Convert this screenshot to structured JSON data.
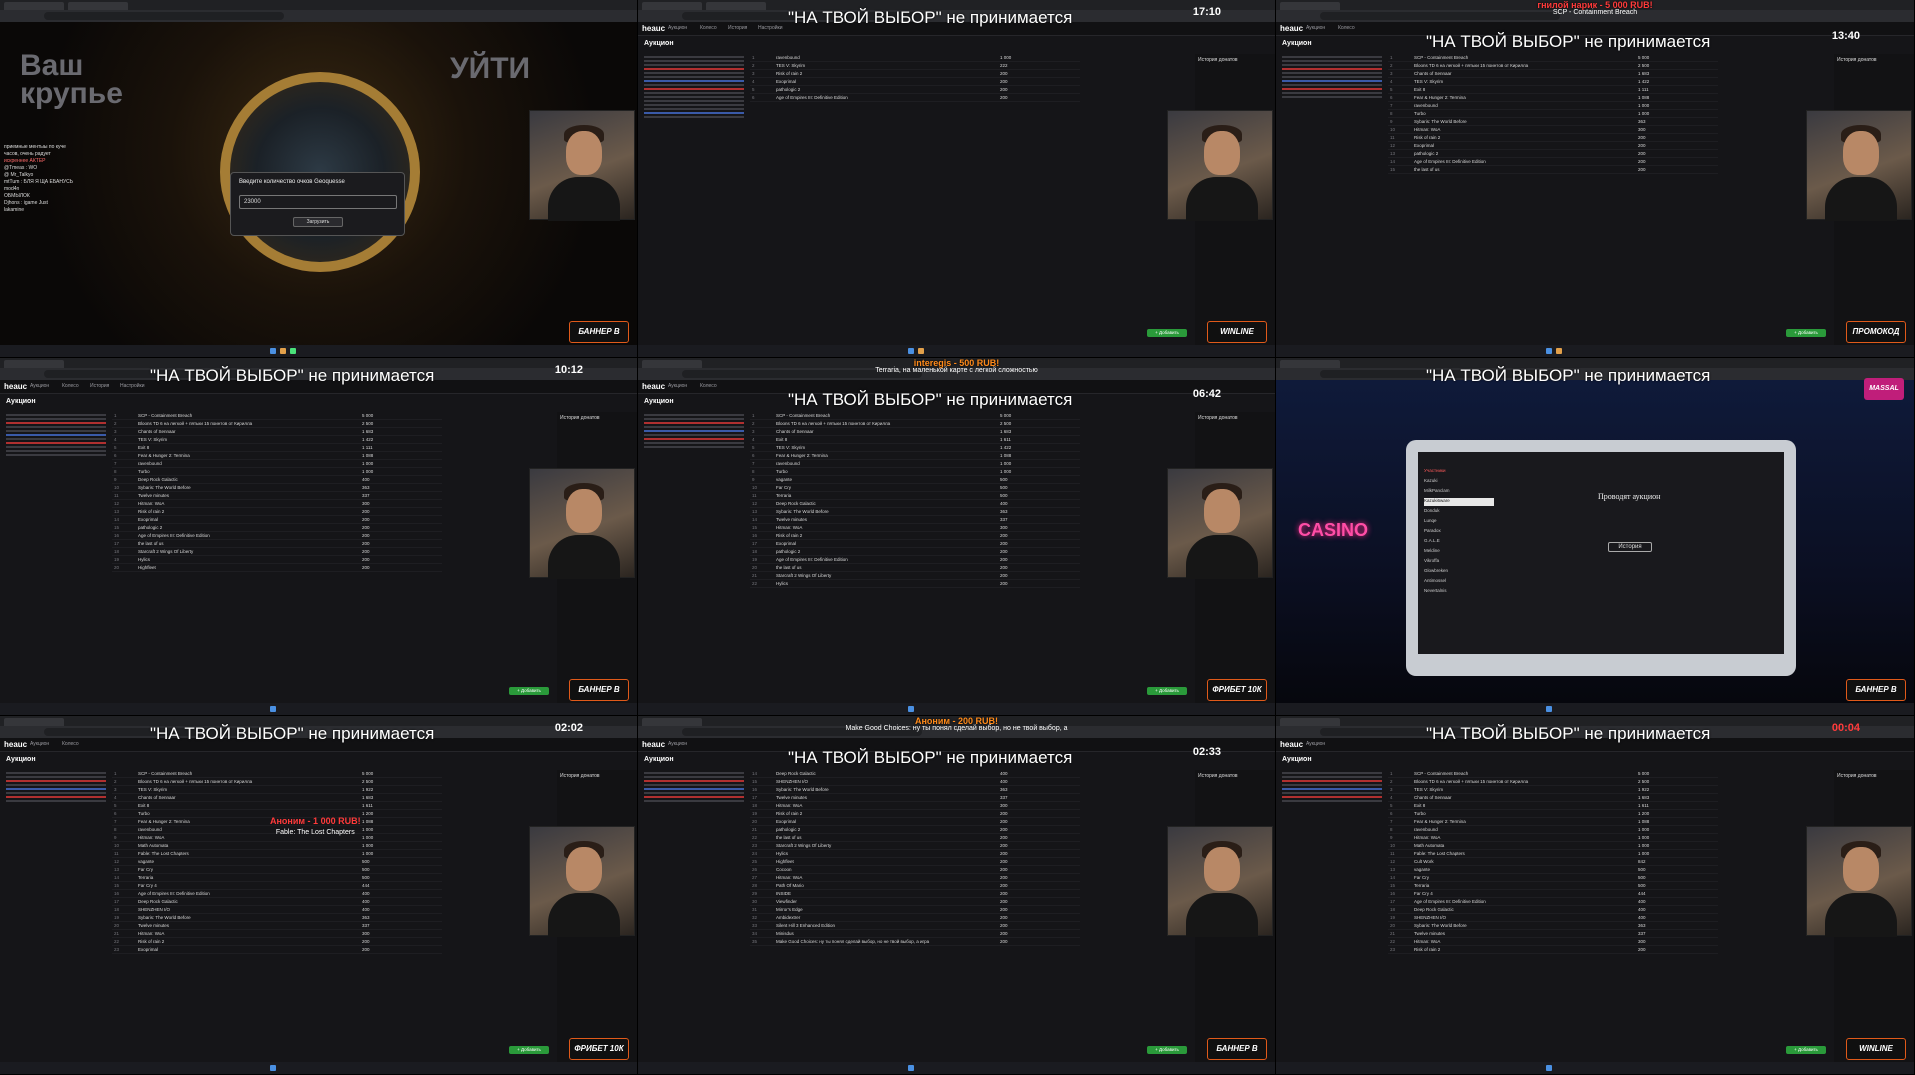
{
  "overlay_banner": "\"НА ТВОЙ ВЫБОР\" не принимается",
  "site": {
    "logo": "heauc",
    "nav": [
      "Аукцион",
      "Колесо",
      "История",
      "Настройки"
    ],
    "auction_label": "Аукцион",
    "add_button": "+ Добавить",
    "history_label": "История донатов"
  },
  "panel1": {
    "left_title": "Ваш крупье",
    "right_title": "УЙТИ",
    "modal_title": "Введите количество очков Geoquesse",
    "modal_value": "23000",
    "modal_button": "Загрузить",
    "chat": [
      "приемные ментыы по куче",
      "часов, очень радует",
      "искреннее АКТЁР",
      "@Tmeas : WO",
      "@ Mr_Talkyo",
      "mtTum : БЛЯ Я ЩА ЕБАНУСЬ",
      "mod4n",
      "ОБМЫЛОК",
      "Djhons : igame Just",
      "lakamine"
    ]
  },
  "panel2": {
    "timer": "17:10",
    "rows": [
      {
        "i": "1",
        "n": "ravenbound",
        "a": "1 000"
      },
      {
        "i": "2",
        "n": "TES V: Skyrim",
        "a": "222"
      },
      {
        "i": "3",
        "n": "Risk of rain 2",
        "a": "200"
      },
      {
        "i": "4",
        "n": "Exoprimal",
        "a": "200"
      },
      {
        "i": "5",
        "n": "pathologic 2",
        "a": "200"
      },
      {
        "i": "6",
        "n": "Age of Empires III: Definitive Edition",
        "a": "200"
      }
    ]
  },
  "panel3": {
    "timer": "13:40",
    "donation": "гнилой нарик - 5 000 RUB!",
    "caption": "SCP - Containment Breach",
    "rows": [
      {
        "i": "1",
        "n": "SCP - Containment Breach",
        "a": "5 000"
      },
      {
        "i": "2",
        "n": "Bloons TD 6 на легкой + пятьки 15 поинтов от Кирилла",
        "a": "2 500"
      },
      {
        "i": "3",
        "n": "Chants of Sennaar",
        "a": "1 683"
      },
      {
        "i": "4",
        "n": "TES V: Skyrim",
        "a": "1 422"
      },
      {
        "i": "5",
        "n": "Exit 8",
        "a": "1 111"
      },
      {
        "i": "6",
        "n": "Fear & Hunger 2: Termina",
        "a": "1 088"
      },
      {
        "i": "7",
        "n": "ravenbound",
        "a": "1 000"
      },
      {
        "i": "8",
        "n": "Turbo",
        "a": "1 000"
      },
      {
        "i": "9",
        "n": "Sybaris: The World Before",
        "a": "363"
      },
      {
        "i": "10",
        "n": "Hitman: WoA",
        "a": "300"
      },
      {
        "i": "11",
        "n": "Risk of rain 2",
        "a": "200"
      },
      {
        "i": "12",
        "n": "Exoprimal",
        "a": "200"
      },
      {
        "i": "13",
        "n": "pathologic 2",
        "a": "200"
      },
      {
        "i": "14",
        "n": "Age of Empires III: Definitive Edition",
        "a": "200"
      },
      {
        "i": "15",
        "n": "the last of us",
        "a": "200"
      }
    ],
    "badge": "ПРОМОКОД MEL"
  },
  "panel4": {
    "timer": "10:12",
    "badge": "БАННЕР В ОПИСАНИИ",
    "rows": [
      {
        "i": "1",
        "n": "SCP - Containment Breach",
        "a": "5 000"
      },
      {
        "i": "2",
        "n": "Bloons TD 6 на легкой + пятьки 15 поинтов от Кирилла",
        "a": "2 500"
      },
      {
        "i": "3",
        "n": "Chants of Sennaar",
        "a": "1 683"
      },
      {
        "i": "4",
        "n": "TES V: Skyrim",
        "a": "1 422"
      },
      {
        "i": "5",
        "n": "Exit 8",
        "a": "1 111"
      },
      {
        "i": "6",
        "n": "Fear & Hunger 2: Termina",
        "a": "1 088"
      },
      {
        "i": "7",
        "n": "ravenbound",
        "a": "1 000"
      },
      {
        "i": "8",
        "n": "Turbo",
        "a": "1 000"
      },
      {
        "i": "9",
        "n": "Deep Rock Galactic",
        "a": "400"
      },
      {
        "i": "10",
        "n": "Sybaris: The World Before",
        "a": "363"
      },
      {
        "i": "11",
        "n": "Twelve minutes",
        "a": "337"
      },
      {
        "i": "12",
        "n": "Hitman: WoA",
        "a": "300"
      },
      {
        "i": "13",
        "n": "Risk of rain 2",
        "a": "200"
      },
      {
        "i": "14",
        "n": "Exoprimal",
        "a": "200"
      },
      {
        "i": "15",
        "n": "pathologic 2",
        "a": "200"
      },
      {
        "i": "16",
        "n": "Age of Empires III: Definitive Edition",
        "a": "200"
      },
      {
        "i": "17",
        "n": "the last of us",
        "a": "200"
      },
      {
        "i": "18",
        "n": "Starcraft 2 Wings Of Liberty",
        "a": "200"
      },
      {
        "i": "19",
        "n": "Hylics",
        "a": "200"
      },
      {
        "i": "20",
        "n": "Highfleet",
        "a": "200"
      }
    ]
  },
  "panel5": {
    "timer": "06:42",
    "donation": "interegis - 500 RUB!",
    "caption": "Terraria, на маленькой карте с легкой сложностью",
    "badge": "ФРИБЕТ 10К",
    "rows": [
      {
        "i": "1",
        "n": "SCP - Containment Breach",
        "a": "5 000"
      },
      {
        "i": "2",
        "n": "Bloons TD 6 на легкой + пятьки 15 поинтов от Кирилла",
        "a": "2 500"
      },
      {
        "i": "3",
        "n": "Chants of Sennaar",
        "a": "1 683"
      },
      {
        "i": "4",
        "n": "Exit 8",
        "a": "1 611"
      },
      {
        "i": "5",
        "n": "TES V: Skyrim",
        "a": "1 422"
      },
      {
        "i": "6",
        "n": "Fear & Hunger 2: Termina",
        "a": "1 088"
      },
      {
        "i": "7",
        "n": "ravenbound",
        "a": "1 000"
      },
      {
        "i": "8",
        "n": "Turbo",
        "a": "1 000"
      },
      {
        "i": "9",
        "n": "vagante",
        "a": "500"
      },
      {
        "i": "10",
        "n": "Far Cry",
        "a": "500"
      },
      {
        "i": "11",
        "n": "Terraria",
        "a": "500"
      },
      {
        "i": "12",
        "n": "Deep Rock Galactic",
        "a": "400"
      },
      {
        "i": "13",
        "n": "Sybaris: The World Before",
        "a": "363"
      },
      {
        "i": "14",
        "n": "Twelve minutes",
        "a": "337"
      },
      {
        "i": "15",
        "n": "Hitman: WoA",
        "a": "300"
      },
      {
        "i": "16",
        "n": "Risk of rain 2",
        "a": "200"
      },
      {
        "i": "17",
        "n": "Exoprimal",
        "a": "200"
      },
      {
        "i": "18",
        "n": "pathologic 2",
        "a": "200"
      },
      {
        "i": "19",
        "n": "Age of Empires III: Definitive Edition",
        "a": "200"
      },
      {
        "i": "20",
        "n": "the last of us",
        "a": "200"
      },
      {
        "i": "21",
        "n": "Starcraft 2 Wings Of Liberty",
        "a": "200"
      },
      {
        "i": "22",
        "n": "Hylics",
        "a": "200"
      }
    ]
  },
  "panel6": {
    "casino_sign": "CASINO",
    "process_text": "Проводят аукцион",
    "history_button": "История",
    "brand_badge": "MASSAL",
    "badge": "БАННЕР В ОПИСАНИИ",
    "participants": [
      "Участники",
      "Kazuki",
      "MilkPanclam",
      "Kazuki6ware",
      "Donduk",
      "Lunqe",
      "Paradox",
      "G.A.L.E",
      "Meldine",
      "Vikroffa",
      "Glowbreken",
      "Antimossel",
      "Nevertalnis"
    ]
  },
  "panel7": {
    "timer": "02:02",
    "donation": "Аноним - 1 000 RUB!",
    "caption": "Fable: The Lost Chapters",
    "badge": "ФРИБЕТ 10К",
    "rows": [
      {
        "i": "1",
        "n": "SCP - Containment Breach",
        "a": "5 000"
      },
      {
        "i": "2",
        "n": "Bloons TD 6 на легкой + пятьки 15 поинтов от Кирилла",
        "a": "2 500"
      },
      {
        "i": "3",
        "n": "TES V: Skyrim",
        "a": "1 922"
      },
      {
        "i": "4",
        "n": "Chants of Sennaar",
        "a": "1 683"
      },
      {
        "i": "5",
        "n": "Exit 8",
        "a": "1 611"
      },
      {
        "i": "6",
        "n": "Turbo",
        "a": "1 200"
      },
      {
        "i": "7",
        "n": "Fear & Hunger 2: Termina",
        "a": "1 088"
      },
      {
        "i": "8",
        "n": "ravenbound",
        "a": "1 000"
      },
      {
        "i": "9",
        "n": "Hitman: WoA",
        "a": "1 000"
      },
      {
        "i": "10",
        "n": "Math Automata",
        "a": "1 000"
      },
      {
        "i": "11",
        "n": "Fable: The Lost Chapters",
        "a": "1 000"
      },
      {
        "i": "12",
        "n": "vagante",
        "a": "500"
      },
      {
        "i": "13",
        "n": "Far Cry",
        "a": "500"
      },
      {
        "i": "14",
        "n": "Terraria",
        "a": "500"
      },
      {
        "i": "15",
        "n": "Far Cry 4",
        "a": "444"
      },
      {
        "i": "16",
        "n": "Age of Empires III: Definitive Edition",
        "a": "400"
      },
      {
        "i": "17",
        "n": "Deep Rock Galactic",
        "a": "400"
      },
      {
        "i": "18",
        "n": "SHENZHEN I/O",
        "a": "400"
      },
      {
        "i": "19",
        "n": "Sybaris: The World Before",
        "a": "363"
      },
      {
        "i": "20",
        "n": "Twelve minutes",
        "a": "337"
      },
      {
        "i": "21",
        "n": "Hitman: WoA",
        "a": "300"
      },
      {
        "i": "22",
        "n": "Risk of rain 2",
        "a": "200"
      },
      {
        "i": "23",
        "n": "Exoprimal",
        "a": "200"
      }
    ]
  },
  "panel8": {
    "timer": "02:33",
    "donation": "Аноним - 200 RUB!",
    "caption": "Make Good Choices: ну ты понял сделай выбор, но не твой выбор, а",
    "rows": [
      {
        "i": "14",
        "n": "Deep Rock Galactic",
        "a": "400"
      },
      {
        "i": "15",
        "n": "SHENZHEN I/O",
        "a": "400"
      },
      {
        "i": "16",
        "n": "Sybaris: The World Before",
        "a": "363"
      },
      {
        "i": "17",
        "n": "Twelve minutes",
        "a": "337"
      },
      {
        "i": "18",
        "n": "Hitman: WoA",
        "a": "300"
      },
      {
        "i": "19",
        "n": "Risk of rain 2",
        "a": "200"
      },
      {
        "i": "20",
        "n": "Exoprimal",
        "a": "200"
      },
      {
        "i": "21",
        "n": "pathologic 2",
        "a": "200"
      },
      {
        "i": "22",
        "n": "the last of us",
        "a": "200"
      },
      {
        "i": "23",
        "n": "Starcraft 2 Wings Of Liberty",
        "a": "200"
      },
      {
        "i": "24",
        "n": "Hylics",
        "a": "200"
      },
      {
        "i": "25",
        "n": "Highfleet",
        "a": "200"
      },
      {
        "i": "26",
        "n": "Cocoon",
        "a": "200"
      },
      {
        "i": "27",
        "n": "Hitman: WoA",
        "a": "200"
      },
      {
        "i": "28",
        "n": "Path Of Mario",
        "a": "200"
      },
      {
        "i": "29",
        "n": "INSIDE",
        "a": "200"
      },
      {
        "i": "30",
        "n": "Viewfinder",
        "a": "200"
      },
      {
        "i": "31",
        "n": "Mirror's Edge",
        "a": "200"
      },
      {
        "i": "32",
        "n": "Ambidextrer",
        "a": "200"
      },
      {
        "i": "33",
        "n": "Silent Hill 3 Enhanced Edition",
        "a": "200"
      },
      {
        "i": "34",
        "n": "Minisdus",
        "a": "200"
      },
      {
        "i": "35",
        "n": "Make Good Choices: ну ты понял сделай выбор, но не твой выбор, а игра",
        "a": "200"
      }
    ]
  },
  "panel9": {
    "timer": "00:04",
    "badge": "WINLINE",
    "rows": [
      {
        "i": "1",
        "n": "SCP - Containment Breach",
        "a": "5 000"
      },
      {
        "i": "2",
        "n": "Bloons TD 6 на легкой + пятьки 15 поинтов от Кирилла",
        "a": "2 500"
      },
      {
        "i": "3",
        "n": "TES V: Skyrim",
        "a": "1 922"
      },
      {
        "i": "4",
        "n": "Chants of Sennaar",
        "a": "1 683"
      },
      {
        "i": "5",
        "n": "Exit 8",
        "a": "1 611"
      },
      {
        "i": "6",
        "n": "Turbo",
        "a": "1 200"
      },
      {
        "i": "7",
        "n": "Fear & Hunger 2: Termina",
        "a": "1 088"
      },
      {
        "i": "8",
        "n": "ravenbound",
        "a": "1 000"
      },
      {
        "i": "9",
        "n": "Hitman: WoA",
        "a": "1 000"
      },
      {
        "i": "10",
        "n": "Math Automata",
        "a": "1 000"
      },
      {
        "i": "11",
        "n": "Fable: The Lost Chapters",
        "a": "1 000"
      },
      {
        "i": "12",
        "n": "Cult Work",
        "a": "842"
      },
      {
        "i": "13",
        "n": "vagante",
        "a": "500"
      },
      {
        "i": "14",
        "n": "Far Cry",
        "a": "500"
      },
      {
        "i": "15",
        "n": "Terraria",
        "a": "500"
      },
      {
        "i": "16",
        "n": "Far Cry 4",
        "a": "444"
      },
      {
        "i": "17",
        "n": "Age of Empires III: Definitive Edition",
        "a": "400"
      },
      {
        "i": "18",
        "n": "Deep Rock Galactic",
        "a": "400"
      },
      {
        "i": "19",
        "n": "SHENZHEN I/O",
        "a": "400"
      },
      {
        "i": "20",
        "n": "Sybaris: The World Before",
        "a": "363"
      },
      {
        "i": "21",
        "n": "Twelve minutes",
        "a": "337"
      },
      {
        "i": "22",
        "n": "Hitman: WoA",
        "a": "300"
      },
      {
        "i": "23",
        "n": "Risk of rain 2",
        "a": "200"
      }
    ]
  }
}
